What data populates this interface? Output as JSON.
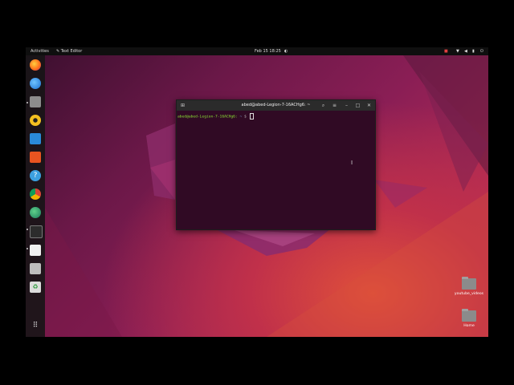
{
  "topbar": {
    "activities": "Activities",
    "app_name": "Text Editor",
    "datetime": "Feb 15  18:25"
  },
  "terminal": {
    "title": "abed@abed-Legion-7-16ACHg6: ~",
    "prompt_user": "abed@abed-Legion-7-16ACHg6:",
    "prompt_path": "~",
    "prompt_symbol": "$"
  },
  "desktop": {
    "items": [
      {
        "label": "youtube_videos"
      },
      {
        "label": "Home"
      }
    ]
  },
  "dock": {
    "apps": [
      "firefox-icon",
      "thunderbird-icon",
      "files-icon",
      "rhythmbox-icon",
      "writer-icon",
      "software-icon",
      "help-icon",
      "chrome-icon",
      "edge-icon",
      "terminal-icon",
      "text-editor-icon",
      "drive-icon",
      "trash-icon",
      "show-apps-icon"
    ]
  },
  "colors": {
    "terminal_bg": "#300a24",
    "prompt_green": "#8ae234",
    "topbar_bg": "#0f0f0f"
  }
}
